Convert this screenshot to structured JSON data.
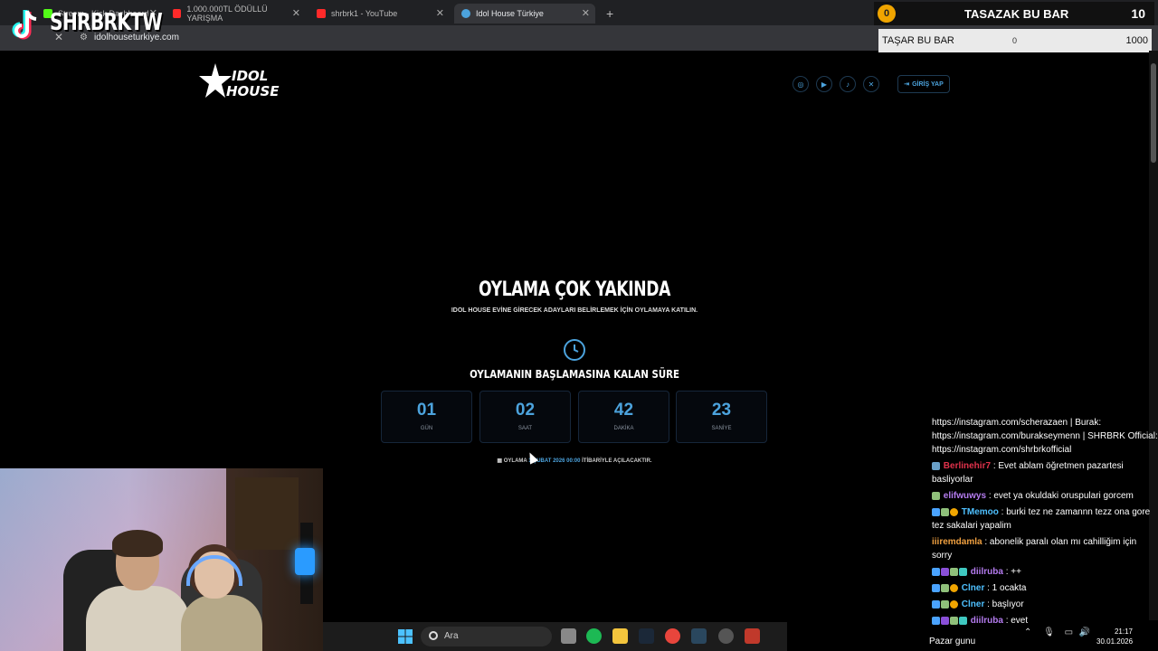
{
  "browser": {
    "tabs": [
      {
        "label": "Stream - Kick Dashboard",
        "active": false
      },
      {
        "label": "1.000.000TL ÖDÜLLÜ YARIŞMA",
        "active": false
      },
      {
        "label": "shrbrk1 - YouTube",
        "active": false
      },
      {
        "label": "Idol House Türkiye",
        "active": true
      }
    ],
    "url": "idolhouseturkiye.com",
    "new_tab": "+"
  },
  "overlay": {
    "channel_name": "SHRBRKTW",
    "widget": {
      "coin": "0",
      "title": "TASAZAK BU BAR",
      "count": "10",
      "bar_label": "TAŞAR BU BAR",
      "bar_min": "0",
      "bar_max": "1000"
    }
  },
  "site": {
    "logo_text": "IDOL HOUSE",
    "socials": [
      "instagram-icon",
      "youtube-icon",
      "tiktok-icon",
      "x-icon"
    ],
    "login_label": "GİRİŞ YAP",
    "hero_title": "OYLAMA ÇOK YAKINDA",
    "hero_subtitle": "IDOL HOUSE EVİNE GİRECEK ADAYLARI BELİRLEMEK İÇİN OYLAMAYA KATILIN.",
    "countdown_title": "OYLAMANIN BAŞLAMASINA KALAN SÜRE",
    "countdown": [
      {
        "value": "01",
        "label": "GÜN"
      },
      {
        "value": "02",
        "label": "SAAT"
      },
      {
        "value": "42",
        "label": "DAKİKA"
      },
      {
        "value": "23",
        "label": "SANİYE"
      }
    ],
    "note_prefix": "OYLAMA",
    "note_date": "1 ŞUBAT 2026 00:00",
    "note_suffix": "İTİBARİYLE AÇILACAKTIR."
  },
  "chat": {
    "messages": [
      {
        "user": "",
        "text": "https://instagram.com/scherazaen | Burak: https://instagram.com/burakseymenn | SHRBRK Official: https://instagram.com/shrbrkofficial",
        "color": "#ffffff"
      },
      {
        "user": "Berlinehir7",
        "text": ": Evet ablam öğretmen pazartesi basliyorlar",
        "color": "#e0324b"
      },
      {
        "user": "elifwuwys",
        "text": ": evet ya okuldaki oruspulari gorcem",
        "color": "#b57cf0"
      },
      {
        "user": "TMemoo",
        "text": ": burki tez ne zamannn tezz ona gore tez sakalari yapalim",
        "color": "#4ec0ff"
      },
      {
        "user": "iiiremdamla",
        "text": ": abonelik paralı olan mı cahilliğim için sorry",
        "color": "#f0a040"
      },
      {
        "user": "diilruba",
        "text": ": ++",
        "color": "#b57cf0"
      },
      {
        "user": "Clner",
        "text": ": 1 ocakta",
        "color": "#4ec0ff"
      },
      {
        "user": "Clner",
        "text": ": başlıyor",
        "color": "#4ec0ff"
      },
      {
        "user": "diilruba",
        "text": ": evet",
        "color": "#b57cf0"
      }
    ]
  },
  "taskbar": {
    "search_placeholder": "Ara",
    "weather": "Pazar gunu",
    "time": "21:17",
    "date": "30.01.2026"
  },
  "colors": {
    "accent": "#4ca3dd",
    "coin": "#f0a500"
  }
}
